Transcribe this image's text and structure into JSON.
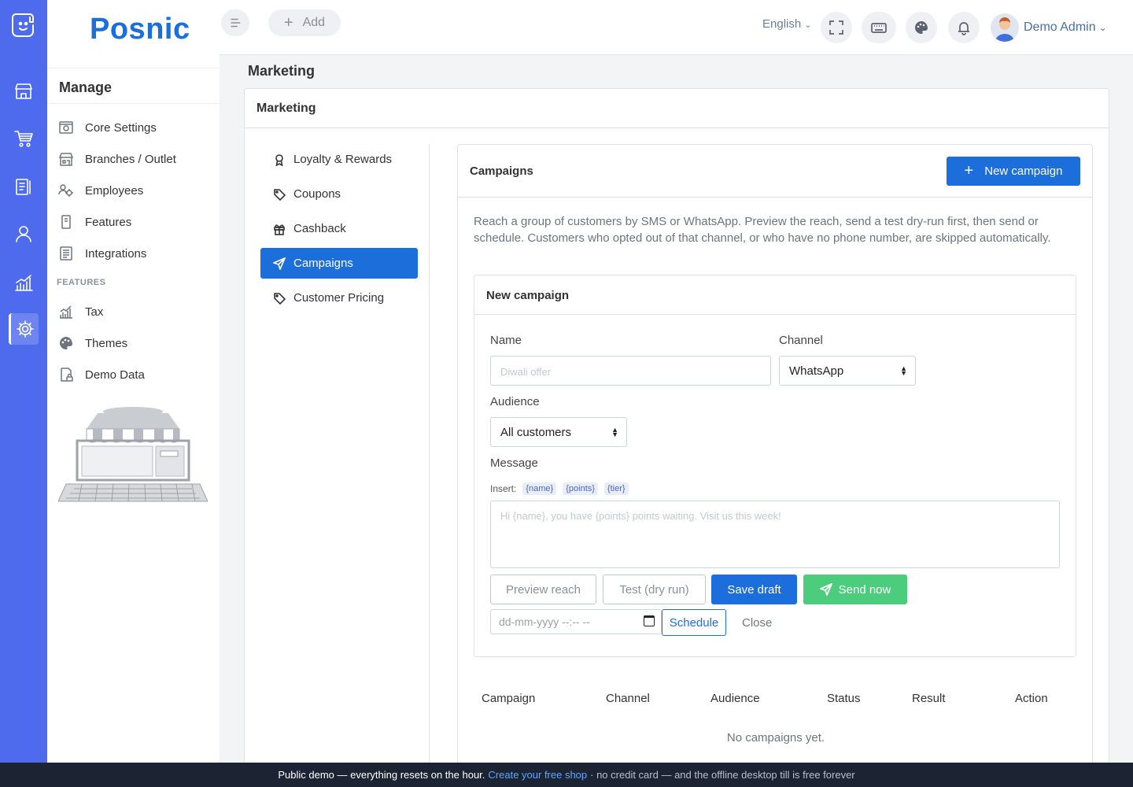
{
  "app": {
    "brand": "Posnic"
  },
  "colors": {
    "rail": "#4f6bed",
    "primary": "#1c6edb",
    "success": "#4ccd7e",
    "footer": "#1c2333"
  },
  "rail": {
    "icons": [
      "logo-icon",
      "store-icon",
      "cart-icon",
      "clipboard-icon",
      "user-icon",
      "chart-icon",
      "settings-icon"
    ],
    "active": "settings-icon"
  },
  "sidebar": {
    "heading": "Manage",
    "items": [
      {
        "label": "Core Settings",
        "icon": "settings-gear-icon"
      },
      {
        "label": "Branches / Outlet",
        "icon": "building-icon"
      },
      {
        "label": "Employees",
        "icon": "employees-icon"
      },
      {
        "label": "Features",
        "icon": "device-icon"
      },
      {
        "label": "Integrations",
        "icon": "list-icon"
      }
    ],
    "section": "FEATURES",
    "feature_items": [
      {
        "label": "Tax",
        "icon": "tax-chart-icon"
      },
      {
        "label": "Themes",
        "icon": "palette-icon"
      },
      {
        "label": "Demo Data",
        "icon": "lock-file-icon"
      }
    ]
  },
  "topbar": {
    "add_label": "Add",
    "language": "English",
    "user": "Demo Admin"
  },
  "page": {
    "title": "Marketing"
  },
  "card": {
    "title": "Marketing"
  },
  "subnav": {
    "items": [
      {
        "label": "Loyalty & Rewards",
        "icon": "award-icon"
      },
      {
        "label": "Coupons",
        "icon": "tag-icon"
      },
      {
        "label": "Cashback",
        "icon": "gift-icon"
      },
      {
        "label": "Campaigns",
        "icon": "send-icon"
      },
      {
        "label": "Customer Pricing",
        "icon": "tag-icon"
      }
    ],
    "active": "Campaigns"
  },
  "campaigns": {
    "title": "Campaigns",
    "new_button": "New campaign",
    "description": "Reach a group of customers by SMS or WhatsApp. Preview the reach, send a test dry-run first, then send or schedule. Customers who opted out of that channel, or who have no phone number, are skipped automatically.",
    "form": {
      "title": "New campaign",
      "name_label": "Name",
      "name_placeholder": "Diwali offer",
      "channel_label": "Channel",
      "channel_value": "WhatsApp",
      "audience_label": "Audience",
      "audience_value": "All customers",
      "message_label": "Message",
      "insert_label": "Insert:",
      "tokens": [
        "{name}",
        "{points}",
        "{tier}"
      ],
      "message_placeholder": "Hi {name}, you have {points} points waiting. Visit us this week!",
      "preview_button": "Preview reach",
      "test_button": "Test (dry run)",
      "save_button": "Save draft",
      "send_button": "Send now",
      "date_placeholder": "dd-mm-yyyy --:-- --",
      "schedule_button": "Schedule",
      "close_link": "Close"
    },
    "table": {
      "columns": [
        "Campaign",
        "Channel",
        "Audience",
        "Status",
        "Result",
        "Action"
      ],
      "empty": "No campaigns yet."
    }
  },
  "footer": {
    "text": "Public demo — everything resets on the hour.",
    "link": "Create your free shop",
    "rest": "· no credit card — and the offline desktop till is free forever"
  }
}
